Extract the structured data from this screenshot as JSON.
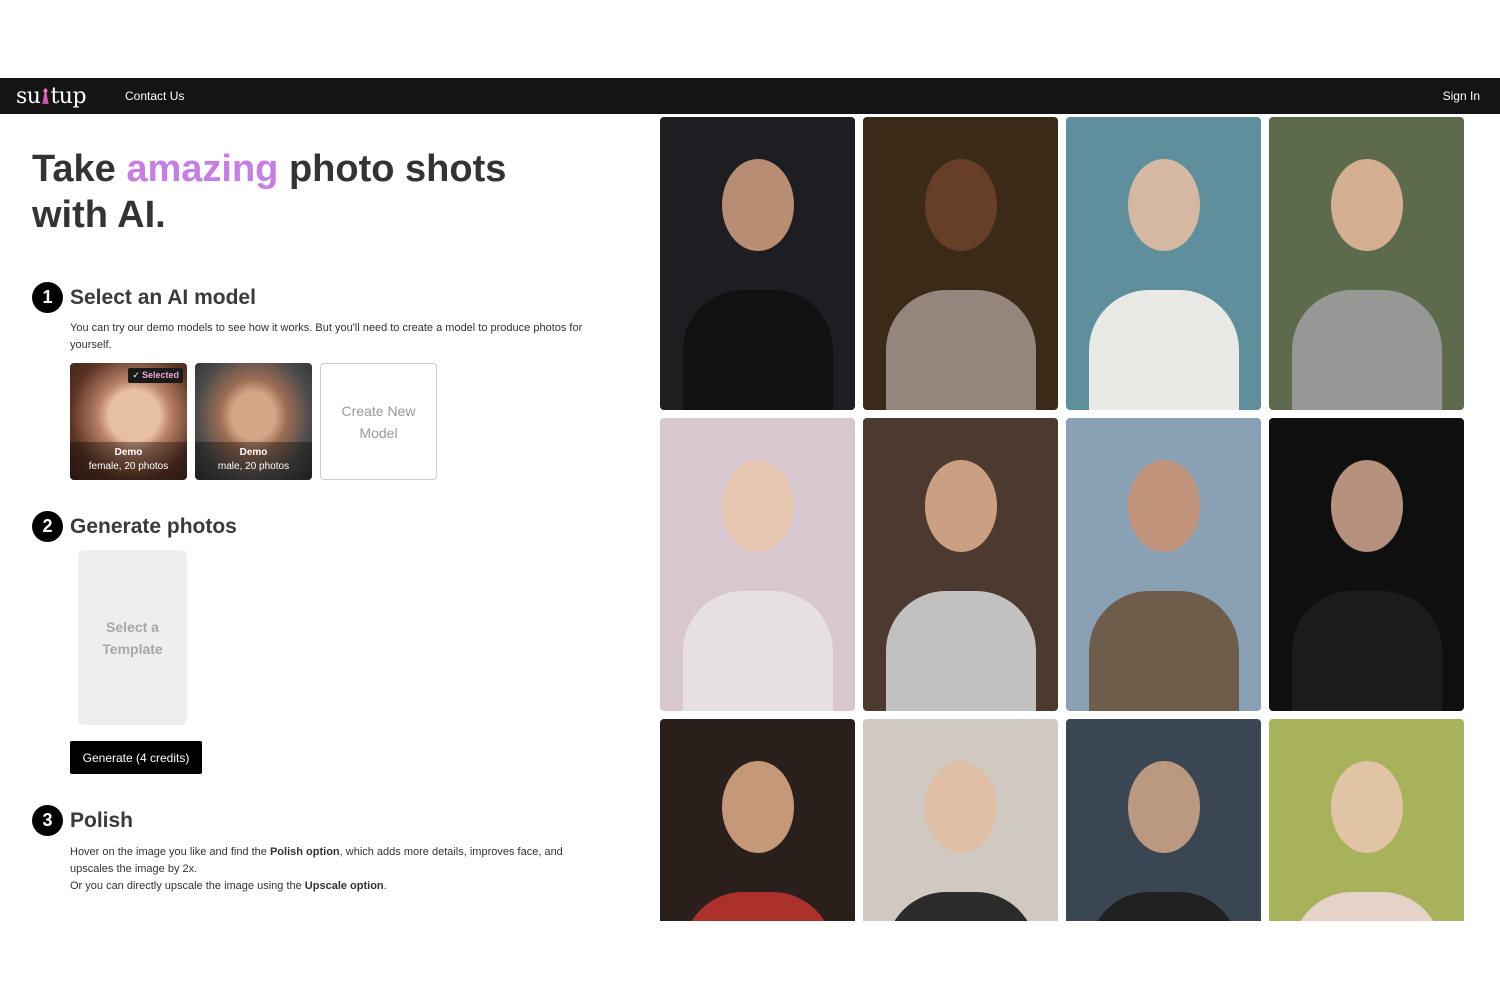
{
  "nav": {
    "logo_text_left": "su",
    "logo_text_right": "tup",
    "contact": "Contact Us",
    "signin": "Sign In"
  },
  "hero": {
    "before": "Take ",
    "accent": "amazing",
    "after": " photo shots with AI.",
    "accent_color": "#c67de6"
  },
  "step1": {
    "num": "1",
    "title": "Select an AI model",
    "desc": "You can try our demo models to see how it works. But you'll need to create a model to produce photos for yourself.",
    "models": [
      {
        "name": "Demo",
        "meta": "female, 20 photos",
        "selected": true,
        "badge": "Selected"
      },
      {
        "name": "Demo",
        "meta": "male, 20 photos",
        "selected": false
      }
    ],
    "create_label": "Create New Model"
  },
  "step2": {
    "num": "2",
    "title": "Generate photos",
    "template_label": "Select a Template",
    "generate_label": "Generate (4 credits)"
  },
  "step3": {
    "num": "3",
    "title": "Polish",
    "line1_a": "Hover on the image you like and find the ",
    "line1_b": "Polish option",
    "line1_c": ", which adds more details, improves face, and upscales the image by 2x.",
    "line2_a": "Or you can directly upscale the image using the ",
    "line2_b": "Upscale option",
    "line2_c": "."
  },
  "gallery": [
    {
      "bg": "#1d1d22",
      "face": "#c99a7c",
      "body": "#111111"
    },
    {
      "bg": "#3b2a18",
      "face": "#6b4128",
      "body": "#9a8a82"
    },
    {
      "bg": "#5f8f9d",
      "face": "#e2bca3",
      "body": "#f0eeea"
    },
    {
      "bg": "#5d6a4c",
      "face": "#e1b898",
      "body": "#9a9a9a"
    },
    {
      "bg": "#d8c7cf",
      "face": "#e8c4ad",
      "body": "#e7e0e4"
    },
    {
      "bg": "#4c3a31",
      "face": "#d9ab8c",
      "body": "#c8c8c8"
    },
    {
      "bg": "#8aa0b5",
      "face": "#c69274",
      "body": "#6b5a44"
    },
    {
      "bg": "#0f0f0f",
      "face": "#c9a08b",
      "body": "#1c1c1c"
    },
    {
      "bg": "#2a1f1a",
      "face": "#d7a585",
      "body": "#b3312d"
    },
    {
      "bg": "#cfc9c2",
      "face": "#e0bea3",
      "body": "#232323"
    },
    {
      "bg": "#3a4652",
      "face": "#caa185",
      "body": "#1f1f1f"
    },
    {
      "bg": "#a8b25a",
      "face": "#e7c4ad",
      "body": "#e8d4cf"
    }
  ]
}
